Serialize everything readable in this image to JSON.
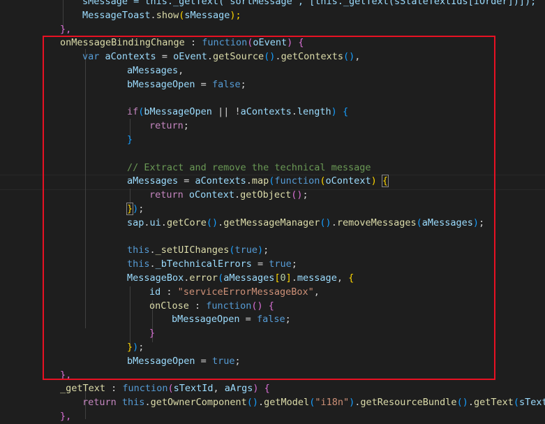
{
  "colors": {
    "background": "#1e1e1e",
    "highlight_border": "#e81123",
    "keyword": "#569cd6",
    "control": "#c586c0",
    "variable": "#9cdcfe",
    "function": "#dcdcaa",
    "class": "#4ec9b0",
    "string": "#ce9178",
    "comment": "#6a9955",
    "bracket_1": "#ffd700",
    "bracket_2": "#da70d6",
    "bracket_3": "#179fff"
  },
  "code_lines": [
    [
      {
        "t": "sMessage = this._getText(\"sortMessage\", [this._getText(sStateTextIds[iOrder])]);",
        "c": "var"
      }
    ],
    [
      {
        "t": "MessageToast",
        "c": "var"
      },
      {
        "t": ".",
        "c": "pl"
      },
      {
        "t": "show",
        "c": "fn"
      },
      {
        "t": "(",
        "c": "p1"
      },
      {
        "t": "sMessage",
        "c": "var"
      },
      {
        "t": ");",
        "c": "p1"
      }
    ],
    [
      {
        "t": "},",
        "c": "p2"
      }
    ],
    [
      {
        "t": "onMessageBindingChange",
        "c": "fn"
      },
      {
        "t": " : ",
        "c": "pl"
      },
      {
        "t": "function",
        "c": "kw"
      },
      {
        "t": "(",
        "c": "p2"
      },
      {
        "t": "oEvent",
        "c": "var"
      },
      {
        "t": ")",
        "c": "p2"
      },
      {
        "t": " {",
        "c": "p2"
      }
    ],
    [
      {
        "t": "var",
        "c": "kw"
      },
      {
        "t": " ",
        "c": "pl"
      },
      {
        "t": "aContexts",
        "c": "var"
      },
      {
        "t": " = ",
        "c": "pl"
      },
      {
        "t": "oEvent",
        "c": "var"
      },
      {
        "t": ".",
        "c": "pl"
      },
      {
        "t": "getSource",
        "c": "fn"
      },
      {
        "t": "()",
        "c": "p3"
      },
      {
        "t": ".",
        "c": "pl"
      },
      {
        "t": "getContexts",
        "c": "fn"
      },
      {
        "t": "()",
        "c": "p3"
      },
      {
        "t": ",",
        "c": "pl"
      }
    ],
    [
      {
        "t": "aMessages",
        "c": "var"
      },
      {
        "t": ",",
        "c": "pl"
      }
    ],
    [
      {
        "t": "bMessageOpen",
        "c": "var"
      },
      {
        "t": " = ",
        "c": "pl"
      },
      {
        "t": "false",
        "c": "kw"
      },
      {
        "t": ";",
        "c": "pl"
      }
    ],
    [],
    [
      {
        "t": "if",
        "c": "ctl"
      },
      {
        "t": "(",
        "c": "p3"
      },
      {
        "t": "bMessageOpen",
        "c": "var"
      },
      {
        "t": " || !",
        "c": "pl"
      },
      {
        "t": "aContexts",
        "c": "var"
      },
      {
        "t": ".",
        "c": "pl"
      },
      {
        "t": "length",
        "c": "var"
      },
      {
        "t": ")",
        "c": "p3"
      },
      {
        "t": " {",
        "c": "p3"
      }
    ],
    [
      {
        "t": "return",
        "c": "ctl"
      },
      {
        "t": ";",
        "c": "pl"
      }
    ],
    [
      {
        "t": "}",
        "c": "p3"
      }
    ],
    [],
    [
      {
        "t": "// Extract and remove the technical message",
        "c": "com"
      }
    ],
    [
      {
        "t": "aMessages",
        "c": "var"
      },
      {
        "t": " = ",
        "c": "pl"
      },
      {
        "t": "aContexts",
        "c": "var"
      },
      {
        "t": ".",
        "c": "pl"
      },
      {
        "t": "map",
        "c": "fn"
      },
      {
        "t": "(",
        "c": "p3"
      },
      {
        "t": "function",
        "c": "kw"
      },
      {
        "t": "(",
        "c": "p1"
      },
      {
        "t": "oContext",
        "c": "var"
      },
      {
        "t": ")",
        "c": "p1"
      },
      {
        "t": " ",
        "c": "pl"
      },
      {
        "t": "{",
        "c": "p1",
        "b": true
      }
    ],
    [
      {
        "t": "return",
        "c": "ctl"
      },
      {
        "t": " ",
        "c": "pl"
      },
      {
        "t": "oContext",
        "c": "var"
      },
      {
        "t": ".",
        "c": "pl"
      },
      {
        "t": "getObject",
        "c": "fn"
      },
      {
        "t": "()",
        "c": "p2"
      },
      {
        "t": ";",
        "c": "pl"
      }
    ],
    [
      {
        "t": "}",
        "c": "p1",
        "b": true
      },
      {
        "t": ")",
        "c": "p3"
      },
      {
        "t": ";",
        "c": "pl"
      }
    ],
    [
      {
        "t": "sap",
        "c": "var"
      },
      {
        "t": ".",
        "c": "pl"
      },
      {
        "t": "ui",
        "c": "var"
      },
      {
        "t": ".",
        "c": "pl"
      },
      {
        "t": "getCore",
        "c": "fn"
      },
      {
        "t": "()",
        "c": "p3"
      },
      {
        "t": ".",
        "c": "pl"
      },
      {
        "t": "getMessageManager",
        "c": "fn"
      },
      {
        "t": "()",
        "c": "p3"
      },
      {
        "t": ".",
        "c": "pl"
      },
      {
        "t": "removeMessages",
        "c": "fn"
      },
      {
        "t": "(",
        "c": "p3"
      },
      {
        "t": "aMessages",
        "c": "var"
      },
      {
        "t": ")",
        "c": "p3"
      },
      {
        "t": ";",
        "c": "pl"
      }
    ],
    [],
    [
      {
        "t": "this",
        "c": "kw"
      },
      {
        "t": ".",
        "c": "pl"
      },
      {
        "t": "_setUIChanges",
        "c": "fn"
      },
      {
        "t": "(",
        "c": "p3"
      },
      {
        "t": "true",
        "c": "kw"
      },
      {
        "t": ")",
        "c": "p3"
      },
      {
        "t": ";",
        "c": "pl"
      }
    ],
    [
      {
        "t": "this",
        "c": "kw"
      },
      {
        "t": ".",
        "c": "pl"
      },
      {
        "t": "_bTechnicalErrors",
        "c": "var"
      },
      {
        "t": " = ",
        "c": "pl"
      },
      {
        "t": "true",
        "c": "kw"
      },
      {
        "t": ";",
        "c": "pl"
      }
    ],
    [
      {
        "t": "MessageBox",
        "c": "var"
      },
      {
        "t": ".",
        "c": "pl"
      },
      {
        "t": "error",
        "c": "fn"
      },
      {
        "t": "(",
        "c": "p3"
      },
      {
        "t": "aMessages",
        "c": "var"
      },
      {
        "t": "[",
        "c": "p1"
      },
      {
        "t": "0",
        "c": "num"
      },
      {
        "t": "]",
        "c": "p1"
      },
      {
        "t": ".",
        "c": "pl"
      },
      {
        "t": "message",
        "c": "var"
      },
      {
        "t": ", ",
        "c": "pl"
      },
      {
        "t": "{",
        "c": "p1"
      }
    ],
    [
      {
        "t": "id",
        "c": "var"
      },
      {
        "t": " : ",
        "c": "pl"
      },
      {
        "t": "\"serviceErrorMessageBox\"",
        "c": "str"
      },
      {
        "t": ",",
        "c": "pl"
      }
    ],
    [
      {
        "t": "onClose",
        "c": "fn"
      },
      {
        "t": " : ",
        "c": "pl"
      },
      {
        "t": "function",
        "c": "kw"
      },
      {
        "t": "()",
        "c": "p2"
      },
      {
        "t": " {",
        "c": "p2"
      }
    ],
    [
      {
        "t": "bMessageOpen",
        "c": "var"
      },
      {
        "t": " = ",
        "c": "pl"
      },
      {
        "t": "false",
        "c": "kw"
      },
      {
        "t": ";",
        "c": "pl"
      }
    ],
    [
      {
        "t": "}",
        "c": "p2"
      }
    ],
    [
      {
        "t": "}",
        "c": "p1"
      },
      {
        "t": ")",
        "c": "p3"
      },
      {
        "t": ";",
        "c": "pl"
      }
    ],
    [
      {
        "t": "bMessageOpen",
        "c": "var"
      },
      {
        "t": " = ",
        "c": "pl"
      },
      {
        "t": "true",
        "c": "kw"
      },
      {
        "t": ";",
        "c": "pl"
      }
    ],
    [
      {
        "t": "},",
        "c": "p2"
      }
    ],
    [
      {
        "t": "_getText",
        "c": "fn"
      },
      {
        "t": " : ",
        "c": "pl"
      },
      {
        "t": "function",
        "c": "kw"
      },
      {
        "t": "(",
        "c": "p2"
      },
      {
        "t": "sTextId",
        "c": "var"
      },
      {
        "t": ", ",
        "c": "pl"
      },
      {
        "t": "aArgs",
        "c": "var"
      },
      {
        "t": ")",
        "c": "p2"
      },
      {
        "t": " {",
        "c": "p2"
      }
    ],
    [
      {
        "t": "return",
        "c": "ctl"
      },
      {
        "t": " ",
        "c": "pl"
      },
      {
        "t": "this",
        "c": "kw"
      },
      {
        "t": ".",
        "c": "pl"
      },
      {
        "t": "getOwnerComponent",
        "c": "fn"
      },
      {
        "t": "()",
        "c": "p3"
      },
      {
        "t": ".",
        "c": "pl"
      },
      {
        "t": "getModel",
        "c": "fn"
      },
      {
        "t": "(",
        "c": "p3"
      },
      {
        "t": "\"i18n\"",
        "c": "str"
      },
      {
        "t": ")",
        "c": "p3"
      },
      {
        "t": ".",
        "c": "pl"
      },
      {
        "t": "getResourceBundle",
        "c": "fn"
      },
      {
        "t": "()",
        "c": "p3"
      },
      {
        "t": ".",
        "c": "pl"
      },
      {
        "t": "getText",
        "c": "fn"
      },
      {
        "t": "(",
        "c": "p3"
      },
      {
        "t": "sTextId",
        "c": "var"
      }
    ],
    [
      {
        "t": "},",
        "c": "p2"
      }
    ]
  ]
}
